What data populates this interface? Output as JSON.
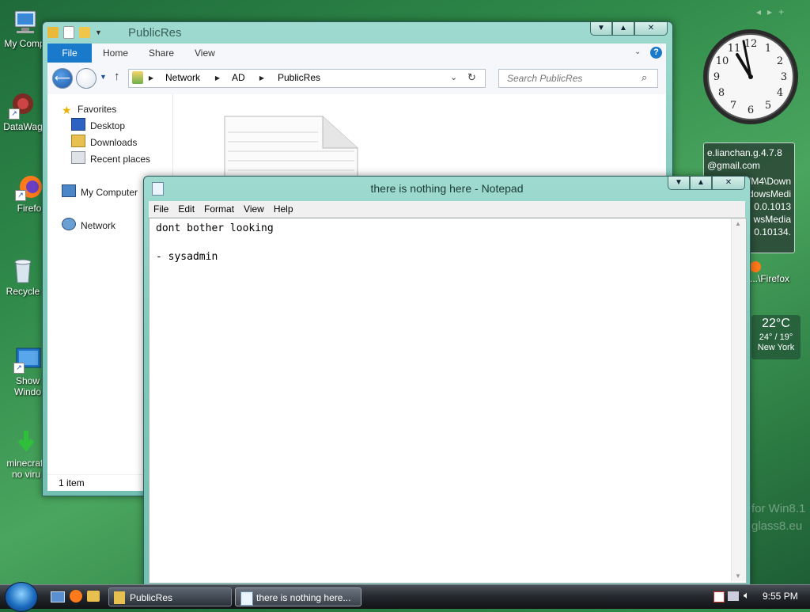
{
  "desktop": {
    "icons": [
      {
        "label": "My Comp"
      },
      {
        "label": "DataWag"
      },
      {
        "label": "Firefo"
      },
      {
        "label": "Recycle"
      },
      {
        "label": "Show\nWindo"
      },
      {
        "label": "minecraft\nno viru"
      }
    ],
    "watermark_line1": "for Win8.1",
    "watermark_line2": "glass8.eu"
  },
  "explorer": {
    "title": "PublicRes",
    "ribbon_tabs": [
      "File",
      "Home",
      "Share",
      "View"
    ],
    "address": [
      "Network",
      "AD",
      "PublicRes"
    ],
    "search_placeholder": "Search PublicRes",
    "nav": {
      "favorites": "Favorites",
      "desktop": "Desktop",
      "downloads": "Downloads",
      "recent": "Recent places",
      "my_computer": "My Computer",
      "network": "Network"
    },
    "status": "1 item"
  },
  "notepad": {
    "title": "there is nothing here - Notepad",
    "menu": [
      "File",
      "Edit",
      "Format",
      "View",
      "Help"
    ],
    "text": "dont bother looking\n\n- sysadmin"
  },
  "gadgets": {
    "clock_time": "11:55",
    "info_lines": [
      "e.lianchan.g.4.7.8",
      "@gmail.com",
      "VM4\\Down",
      "dowsMedi",
      "0.0.1013",
      "wsMedia",
      "0.10134."
    ],
    "info_firefox": "...\\Firefox",
    "weather_temp": "22°C",
    "weather_range": "24° / 19°",
    "weather_city": "New York"
  },
  "taskbar": {
    "buttons": [
      "PublicRes",
      "there is nothing here..."
    ],
    "time": "9:55 PM"
  }
}
